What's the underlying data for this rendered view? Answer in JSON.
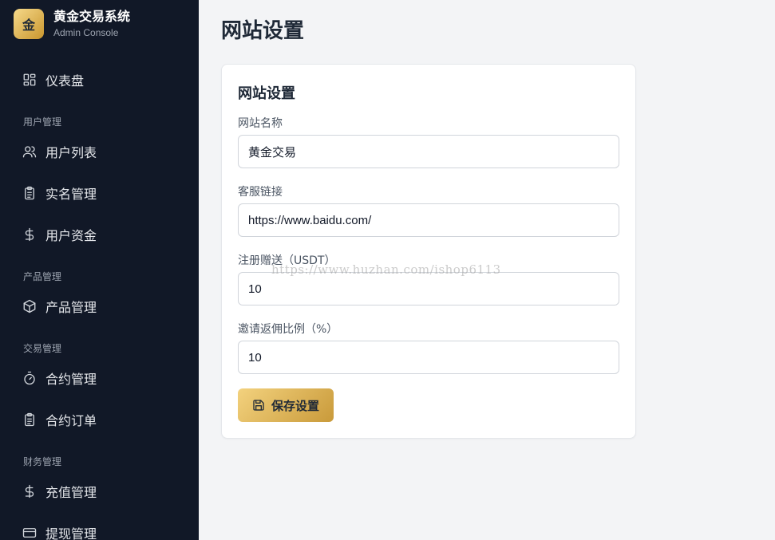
{
  "brand": {
    "logo_char": "金",
    "title": "黄金交易系统",
    "subtitle": "Admin Console"
  },
  "sidebar": {
    "dashboard": {
      "label": "仪表盘",
      "icon": "dashboard-icon"
    },
    "groups": [
      {
        "title": "用户管理",
        "items": [
          {
            "label": "用户列表",
            "icon": "users-icon"
          },
          {
            "label": "实名管理",
            "icon": "clipboard-icon"
          },
          {
            "label": "用户资金",
            "icon": "dollar-icon"
          }
        ]
      },
      {
        "title": "产品管理",
        "items": [
          {
            "label": "产品管理",
            "icon": "box-icon"
          }
        ]
      },
      {
        "title": "交易管理",
        "items": [
          {
            "label": "合约管理",
            "icon": "timer-icon"
          },
          {
            "label": "合约订单",
            "icon": "clipboard-icon"
          }
        ]
      },
      {
        "title": "财务管理",
        "items": [
          {
            "label": "充值管理",
            "icon": "dollar-icon"
          },
          {
            "label": "提现管理",
            "icon": "credit-card-icon"
          }
        ]
      }
    ]
  },
  "main": {
    "page_title": "网站设置",
    "card": {
      "title": "网站设置",
      "fields": [
        {
          "label": "网站名称",
          "value": "黄金交易"
        },
        {
          "label": "客服链接",
          "value": "https://www.baidu.com/"
        },
        {
          "label": "注册赠送（USDT）",
          "value": "10"
        },
        {
          "label": "邀请返佣比例（%）",
          "value": "10"
        }
      ],
      "save_label": "保存设置"
    }
  },
  "watermark": "https://www.huzhan.com/ishop6113",
  "colors": {
    "sidebar_bg": "#111827",
    "accent_gold": "#d9ad52",
    "page_bg": "#f3f4f6"
  }
}
